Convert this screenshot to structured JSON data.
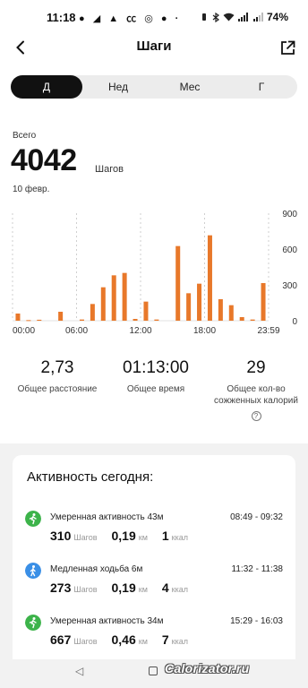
{
  "status_bar": {
    "time": "11:18",
    "notification_icons": "● ◢ ▲ ㏄ ◎ ● ·",
    "battery": "74%"
  },
  "header": {
    "title": "Шаги",
    "back_icon": "chevron-left",
    "share_icon": "external-link"
  },
  "tabs": [
    {
      "label": "Д",
      "active": true
    },
    {
      "label": "Нед",
      "active": false
    },
    {
      "label": "Мес",
      "active": false
    },
    {
      "label": "Г",
      "active": false
    }
  ],
  "summary": {
    "total_label": "Всего",
    "total_value": "4042",
    "total_unit": "Шагов",
    "date": "10 февр."
  },
  "chart_data": {
    "type": "bar",
    "bar_color": "#e8782a",
    "x_tick_labels": [
      "00:00",
      "06:00",
      "12:00",
      "18:00",
      "23:59"
    ],
    "y_tick_labels": [
      "900",
      "600",
      "300",
      "0"
    ],
    "ylim": [
      0,
      900
    ],
    "xlim": [
      0,
      24
    ],
    "x": [
      0.5,
      1.5,
      2.5,
      4.5,
      6.5,
      7.5,
      8.5,
      9.5,
      10.5,
      11.5,
      12.5,
      13.5,
      15.5,
      16.5,
      17.5,
      18.5,
      19.5,
      20.5,
      21.5,
      22.5,
      23.5
    ],
    "values": [
      60,
      5,
      8,
      75,
      10,
      140,
      280,
      380,
      400,
      15,
      160,
      10,
      625,
      230,
      310,
      715,
      180,
      130,
      30,
      10,
      315
    ]
  },
  "stats": [
    {
      "value": "2,73",
      "label": "Общее расстояние"
    },
    {
      "value": "01:13:00",
      "label": "Общее время"
    },
    {
      "value": "29",
      "label": "Общее кол-во сожженных калорий"
    }
  ],
  "activity": {
    "title": "Активность сегодня:",
    "items": [
      {
        "icon": "run-icon",
        "icon_color": "#3cb34a",
        "name": "Умеренная активность 43м",
        "time": "08:49 - 09:32",
        "steps": "310",
        "steps_unit": "Шагов",
        "distance": "0,19",
        "distance_unit": "км",
        "calories": "1",
        "calories_unit": "ккал"
      },
      {
        "icon": "walk-icon",
        "icon_color": "#3a8fe6",
        "name": "Медленная ходьба 6м",
        "time": "11:32 - 11:38",
        "steps": "273",
        "steps_unit": "Шагов",
        "distance": "0,19",
        "distance_unit": "км",
        "calories": "4",
        "calories_unit": "ккал"
      },
      {
        "icon": "run-icon",
        "icon_color": "#3cb34a",
        "name": "Умеренная активность 34м",
        "time": "15:29 - 16:03",
        "steps": "667",
        "steps_unit": "Шагов",
        "distance": "0,46",
        "distance_unit": "км",
        "calories": "7",
        "calories_unit": "ккал"
      }
    ]
  },
  "watermark": "Calorizator.ru"
}
